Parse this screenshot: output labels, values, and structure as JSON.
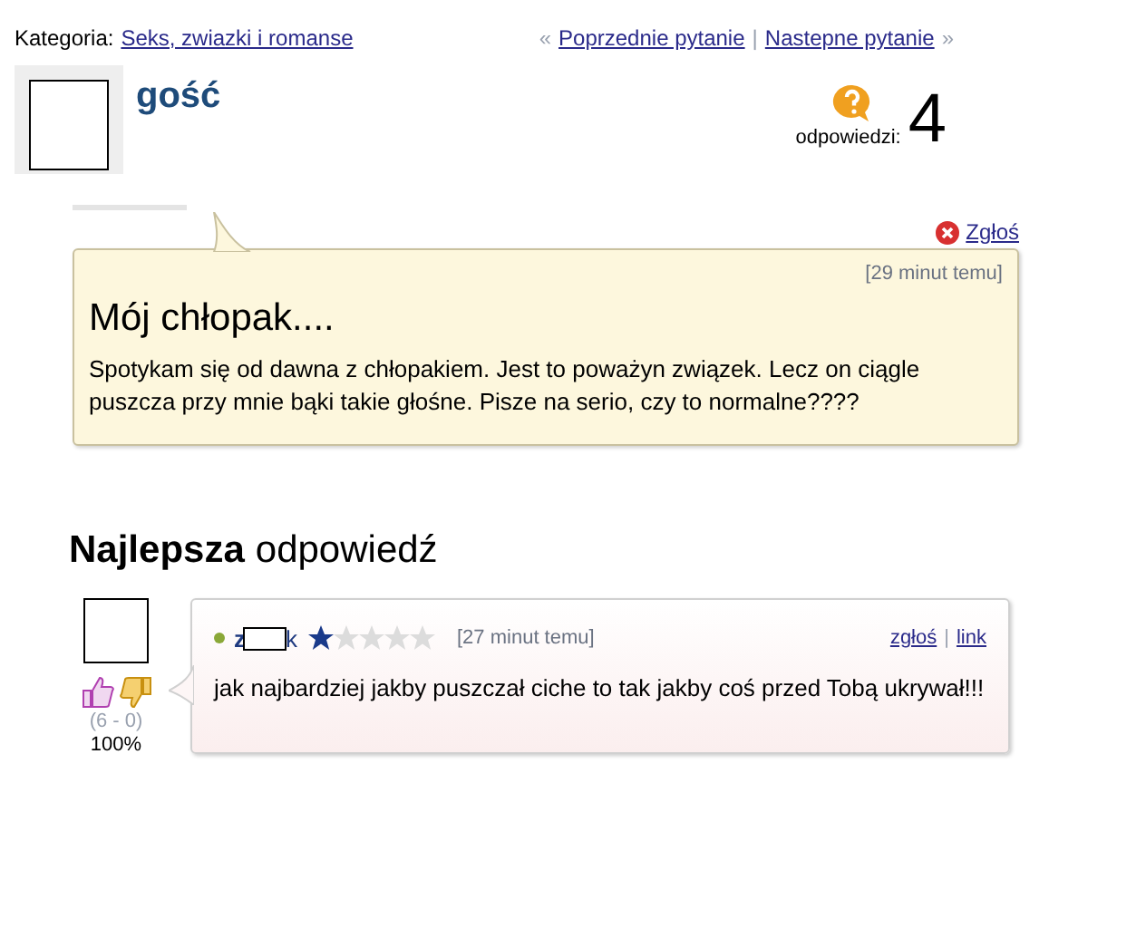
{
  "breadcrumb": {
    "label": "Kategoria:",
    "category": "Seks, zwiazki i romanse"
  },
  "nav": {
    "prev_mark": "«",
    "prev": "Poprzednie pytanie",
    "separator": "|",
    "next": "Nastepne pytanie",
    "next_mark": "»"
  },
  "question": {
    "author": "gość",
    "answers_label": "odpowiedzi:",
    "answers_count": "4",
    "report": "Zgłoś",
    "time": "[29 minut temu]",
    "title": "Mój chłopak....",
    "body": "Spotykam się od dawna z chłopakiem. Jest to poważyn związek. Lecz on ciągle puszcza przy mnie bąki takie głośne. Pisze na serio, czy to normalne????"
  },
  "best_answer": {
    "heading_bold": "Najlepsza",
    "heading_rest": "odpowiedź",
    "votes": "(6 - 0)",
    "percent": "100%",
    "online": true,
    "author_start": "z",
    "author_end": "k",
    "stars": 1,
    "time": "[27 minut temu]",
    "report": "zgłoś",
    "separator": "|",
    "link": "link",
    "body": "jak najbardziej jakby puszczał ciche to tak jakby coś przed Tobą ukrywał!!!"
  }
}
